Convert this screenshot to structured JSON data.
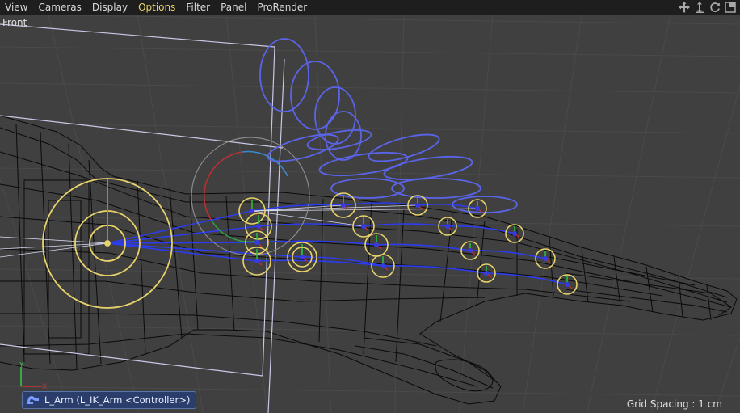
{
  "menu": {
    "items": [
      {
        "label": "View"
      },
      {
        "label": "Cameras"
      },
      {
        "label": "Display"
      },
      {
        "label": "Options",
        "active": true
      },
      {
        "label": "Filter"
      },
      {
        "label": "Panel"
      },
      {
        "label": "ProRender"
      }
    ]
  },
  "view_controls": [
    {
      "icon": "move-view-icon"
    },
    {
      "icon": "zoom-view-icon"
    },
    {
      "icon": "rotate-view-icon"
    },
    {
      "icon": "switch-view-icon"
    }
  ],
  "viewport": {
    "label": "Front",
    "grid_spacing": "Grid Spacing : 1 cm",
    "selection": {
      "icon": "ik-tag-icon",
      "label": "L_Arm (L_IK_Arm <Controller>)"
    }
  },
  "colors": {
    "menubar_bg": "#1e1e1e",
    "viewport_bg": "#404040",
    "grid": "#4a4a4a",
    "controller": "#e8d36a",
    "joint": "#3a3ae0",
    "wire": "#0a0a0a",
    "active_menu": "#e6d36a"
  }
}
